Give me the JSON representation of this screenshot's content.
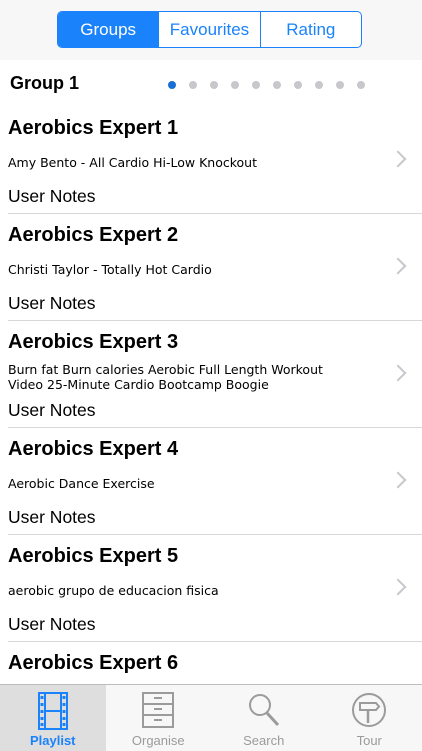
{
  "segments": [
    {
      "label": "Groups"
    },
    {
      "label": "Favourites"
    },
    {
      "label": "Rating"
    }
  ],
  "group": {
    "title": "Group 1",
    "page_count": 10,
    "current_page": 1
  },
  "items": [
    {
      "title": "Aerobics Expert 1",
      "subtitle": "Amy Bento - All Cardio Hi-Low Knockout",
      "notes": "User Notes"
    },
    {
      "title": "Aerobics Expert 2",
      "subtitle": "Christi Taylor - Totally Hot Cardio",
      "notes": "User Notes"
    },
    {
      "title": "Aerobics Expert 3",
      "subtitle": "Burn fat Burn calories Aerobic Full Length Workout Video 25-Minute Cardio Bootcamp Boogie",
      "notes": "User Notes"
    },
    {
      "title": "Aerobics Expert 4",
      "subtitle": "Aerobic Dance Exercise",
      "notes": "User Notes"
    },
    {
      "title": "Aerobics Expert 5",
      "subtitle": "aerobic grupo de educacion fisica",
      "notes": "User Notes"
    },
    {
      "title": "Aerobics Expert 6"
    }
  ],
  "tabs": [
    {
      "label": "Playlist",
      "icon": "film-icon"
    },
    {
      "label": "Organise",
      "icon": "cabinet-icon"
    },
    {
      "label": "Search",
      "icon": "magnifier-icon"
    },
    {
      "label": "Tour",
      "icon": "signpost-icon"
    }
  ],
  "colors": {
    "accent": "#1a82fb",
    "tab_inactive": "#9b9b9b"
  }
}
